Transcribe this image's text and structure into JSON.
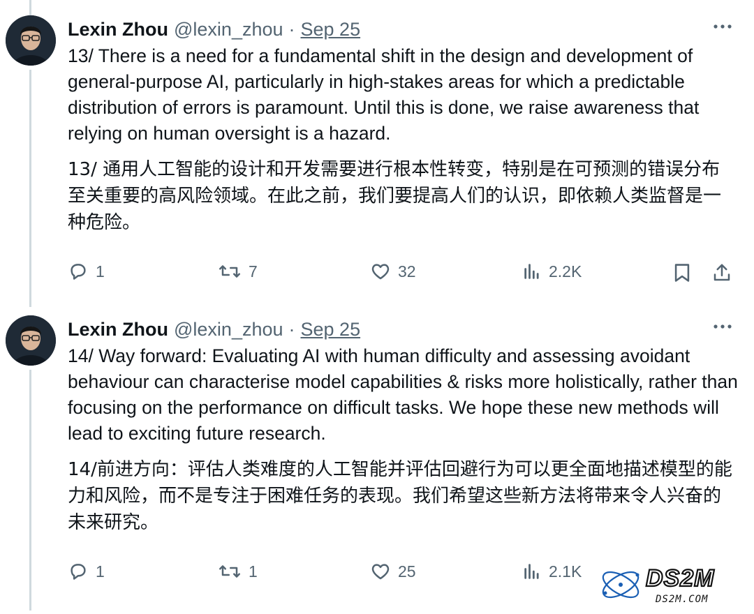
{
  "tweets": [
    {
      "author_name": "Lexin Zhou",
      "handle": "@lexin_zhou",
      "separator": "·",
      "date": "Sep 25",
      "text_en": "13/ There is a need for a fundamental shift in the design and development of general-purpose AI, particularly in high-stakes areas for which a predictable distribution of errors is paramount. Until this is done, we raise awareness that relying on human oversight is a hazard.",
      "text_zh": "13/ 通用人工智能的设计和开发需要进行根本性转变，特别是在可预测的错误分布至关重要的高风险领域。在此之前，我们要提高人们的认识，即依赖人类监督是一种危险。",
      "replies": "1",
      "reposts": "7",
      "likes": "32",
      "views": "2.2K"
    },
    {
      "author_name": "Lexin Zhou",
      "handle": "@lexin_zhou",
      "separator": "·",
      "date": "Sep 25",
      "text_en": "14/ Way forward: Evaluating AI with human difficulty and assessing avoidant behaviour can characterise model capabilities & risks more holistically, rather than focusing on the performance on difficult tasks. We hope these new methods will lead to exciting future research.",
      "text_zh": "14/前进方向：评估人类难度的人工智能并评估回避行为可以更全面地描述模型的能力和风险，而不是专注于困难任务的表现。我们希望这些新方法将带来令人兴奋的未来研究。",
      "replies": "1",
      "reposts": "1",
      "likes": "25",
      "views": "2.1K"
    }
  ],
  "watermark": {
    "brand": "DS2M",
    "url": "DS2M.COM"
  },
  "colors": {
    "text": "#0f1419",
    "secondary": "#536471",
    "thread_line": "#cfd9de",
    "watermark_blue": "#1a5fb4"
  },
  "icons": [
    "more-icon",
    "reply-icon",
    "repost-icon",
    "like-icon",
    "views-icon",
    "bookmark-icon",
    "share-icon"
  ]
}
